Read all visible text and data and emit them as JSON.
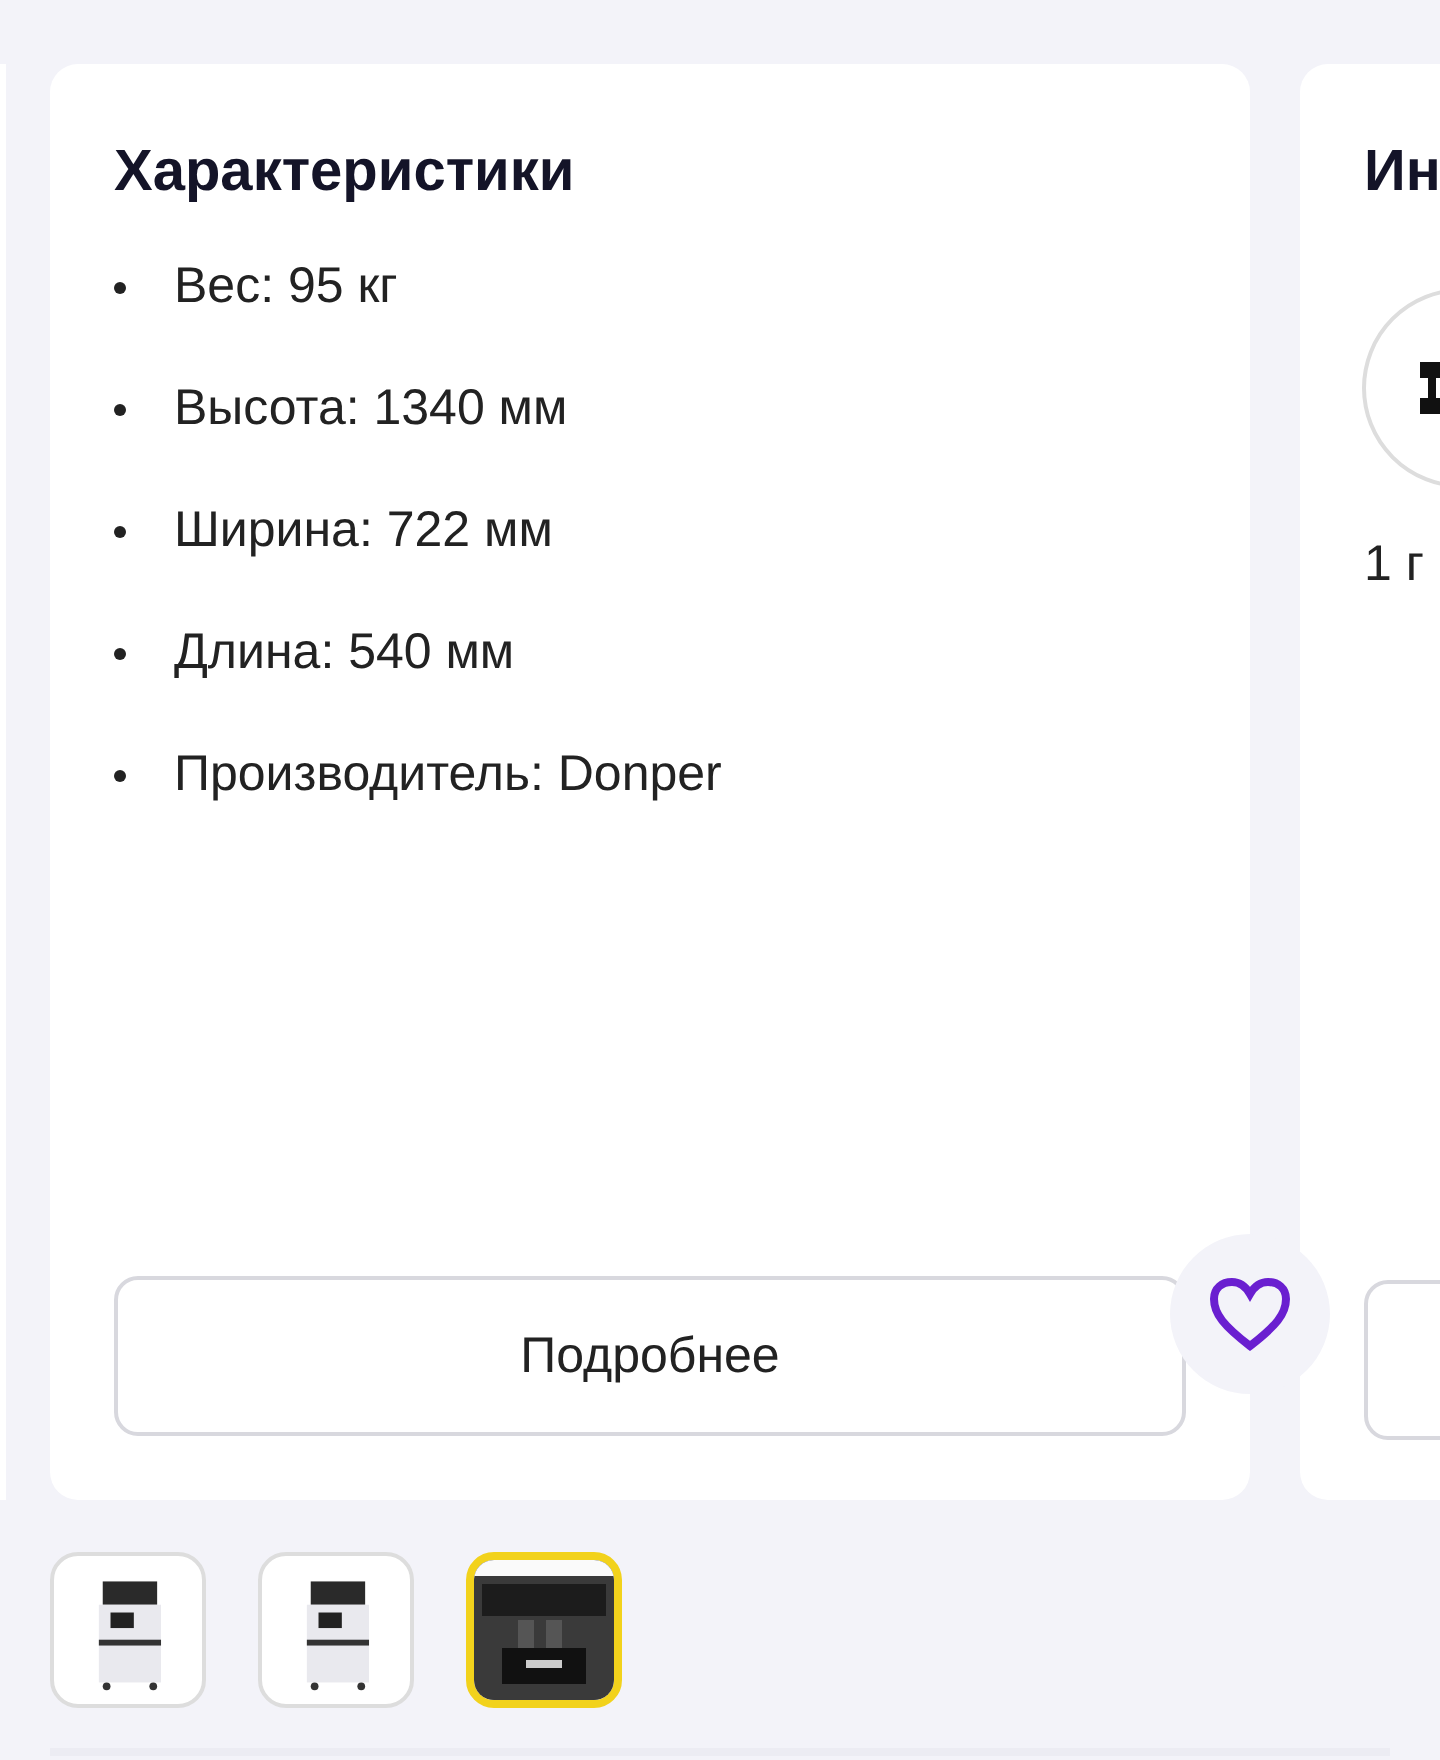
{
  "cards": [
    {
      "title": "Характеристики",
      "specs": [
        "Вес: 95 кг",
        "Высота: 1340 мм",
        "Ширина: 722 мм",
        "Длина: 540 мм",
        "Производитель: Donper"
      ],
      "button": "Подробнее",
      "favorite": false
    },
    {
      "title": "Ин",
      "caption": "1 г"
    }
  ],
  "thumbnails": [
    {
      "kind": "picture",
      "selected": false
    },
    {
      "kind": "picture",
      "selected": false
    },
    {
      "kind": "picture",
      "selected": true
    }
  ]
}
